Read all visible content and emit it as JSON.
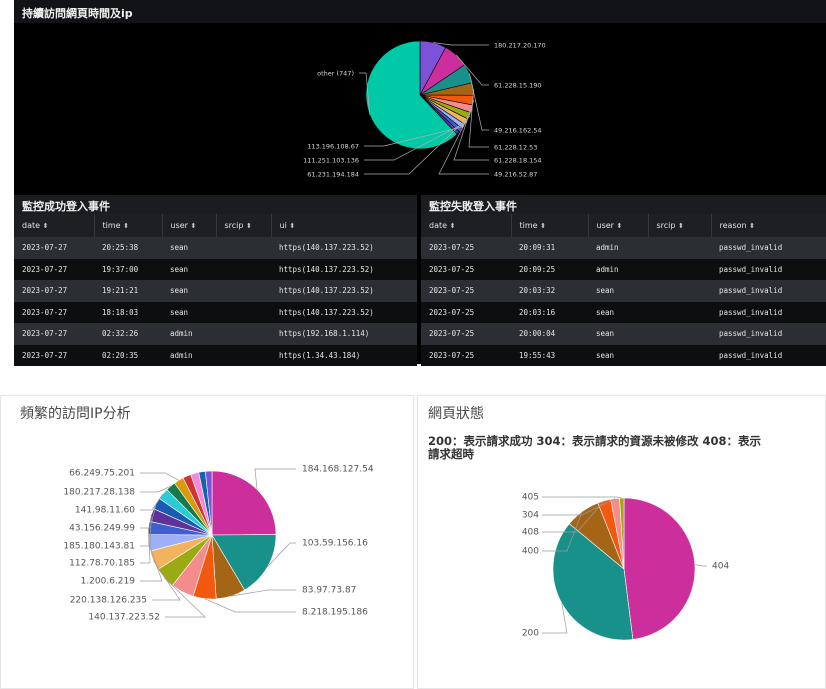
{
  "top_panel": {
    "title": "持續訪問網頁時間及ip"
  },
  "top_pie": {
    "chart_data": {
      "type": "pie",
      "title": "持續訪問網頁時間及ip",
      "slices": [
        {
          "label": "180.217.20.170",
          "value": 95,
          "color": "#7b52d8"
        },
        {
          "label": "61.228.15.190",
          "value": 92,
          "color": "#cc2e9c"
        },
        {
          "label": "49.216.162.54",
          "value": 70,
          "color": "#17918a"
        },
        {
          "label": "61.228.12.53",
          "value": 45,
          "color": "#a56517"
        },
        {
          "label": "61.228.18.154",
          "value": 35,
          "color": "#f2590f"
        },
        {
          "label": "49.216.52.87",
          "value": 28,
          "color": "#f58c8c"
        },
        {
          "label": "61.231.194.184",
          "value": 25,
          "color": "#9aaa14"
        },
        {
          "label": "111.251.103.136",
          "value": 22,
          "color": "#f2b35e"
        },
        {
          "label": "113.196.108.67",
          "value": 18,
          "color": "#9db0f7"
        },
        {
          "label": "",
          "value": 15,
          "color": "#3f5fd1"
        },
        {
          "label": "",
          "value": 12,
          "color": "#5e3399"
        },
        {
          "label": "other (747)",
          "value": 747,
          "color": "#00c9a7"
        }
      ]
    }
  },
  "success_panel": {
    "title": "監控成功登入事件",
    "columns": [
      "date",
      "time",
      "user",
      "srcip",
      "ui"
    ],
    "rows": [
      [
        "2023-07-27",
        "20:25:38",
        "sean",
        "",
        "https(140.137.223.52)"
      ],
      [
        "2023-07-27",
        "19:37:00",
        "sean",
        "",
        "https(140.137.223.52)"
      ],
      [
        "2023-07-27",
        "19:21:21",
        "sean",
        "",
        "https(140.137.223.52)"
      ],
      [
        "2023-07-27",
        "18:18:03",
        "sean",
        "",
        "https(140.137.223.52)"
      ],
      [
        "2023-07-27",
        "02:32:26",
        "admin",
        "",
        "https(192.168.1.114)"
      ],
      [
        "2023-07-27",
        "02:20:35",
        "admin",
        "",
        "https(1.34.43.184)"
      ]
    ]
  },
  "fail_panel": {
    "title": "監控失敗登入事件",
    "columns": [
      "date",
      "time",
      "user",
      "srcip",
      "reason"
    ],
    "rows": [
      [
        "2023-07-25",
        "20:09:31",
        "admin",
        "",
        "passwd_invalid"
      ],
      [
        "2023-07-25",
        "20:09:25",
        "admin",
        "",
        "passwd_invalid"
      ],
      [
        "2023-07-25",
        "20:03:32",
        "sean",
        "",
        "passwd_invalid"
      ],
      [
        "2023-07-25",
        "20:03:16",
        "sean",
        "",
        "passwd_invalid"
      ],
      [
        "2023-07-25",
        "20:00:04",
        "sean",
        "",
        "passwd_invalid"
      ],
      [
        "2023-07-25",
        "19:55:43",
        "sean",
        "",
        "passwd_invalid"
      ]
    ]
  },
  "sort_icon": "⬍",
  "freq_panel": {
    "title": "頻繁的訪問IP分析"
  },
  "freq_pie": {
    "chart_data": {
      "type": "pie",
      "title": "頻繁的訪問IP分析",
      "slices": [
        {
          "label": "184.168.127.54",
          "value": 60,
          "color": "#cc2e9c"
        },
        {
          "label": "103.59.156.16",
          "value": 40,
          "color": "#17918a"
        },
        {
          "label": "83.97.73.87",
          "value": 18,
          "color": "#a56517"
        },
        {
          "label": "8.218.195.186",
          "value": 14,
          "color": "#f2590f"
        },
        {
          "label": "",
          "value": 14,
          "color": "#f58c8c"
        },
        {
          "label": "140.137.223.52",
          "value": 13,
          "color": "#9aaa14"
        },
        {
          "label": "220.138.126.235",
          "value": 12,
          "color": "#f2b35e"
        },
        {
          "label": "1.200.6.219",
          "value": 10,
          "color": "#9db0f7"
        },
        {
          "label": "112.78.70.185",
          "value": 8,
          "color": "#3f5fd1"
        },
        {
          "label": "185.180.143.81",
          "value": 8,
          "color": "#5e3399"
        },
        {
          "label": "43.156.249.99",
          "value": 7,
          "color": "#1a5ab0"
        },
        {
          "label": "141.98.11.60",
          "value": 7,
          "color": "#2cc9d6"
        },
        {
          "label": "180.217.28.138",
          "value": 6,
          "color": "#17784c"
        },
        {
          "label": "66.249.75.201",
          "value": 6,
          "color": "#d89a08"
        },
        {
          "label": "",
          "value": 5,
          "color": "#cf3333"
        },
        {
          "label": "",
          "value": 5,
          "color": "#f28ad8"
        },
        {
          "label": "",
          "value": 4,
          "color": "#1563a8"
        },
        {
          "label": "",
          "value": 4,
          "color": "#7b52d8"
        }
      ]
    }
  },
  "status_panel": {
    "title": "網頁狀態",
    "subtitle_line1": "200：表示請求成功 304：表示請求的資源未被修改 408：表示",
    "subtitle_line2": "請求超時"
  },
  "status_pie": {
    "chart_data": {
      "type": "pie",
      "slices": [
        {
          "label": "404",
          "value": 48,
          "color": "#cc2e9c"
        },
        {
          "label": "200",
          "value": 38,
          "color": "#17918a"
        },
        {
          "label": "400",
          "value": 8,
          "color": "#a56517"
        },
        {
          "label": "408",
          "value": 3,
          "color": "#f2590f"
        },
        {
          "label": "304",
          "value": 2,
          "color": "#f58c8c"
        },
        {
          "label": "405",
          "value": 1,
          "color": "#9aaa14"
        }
      ]
    }
  }
}
